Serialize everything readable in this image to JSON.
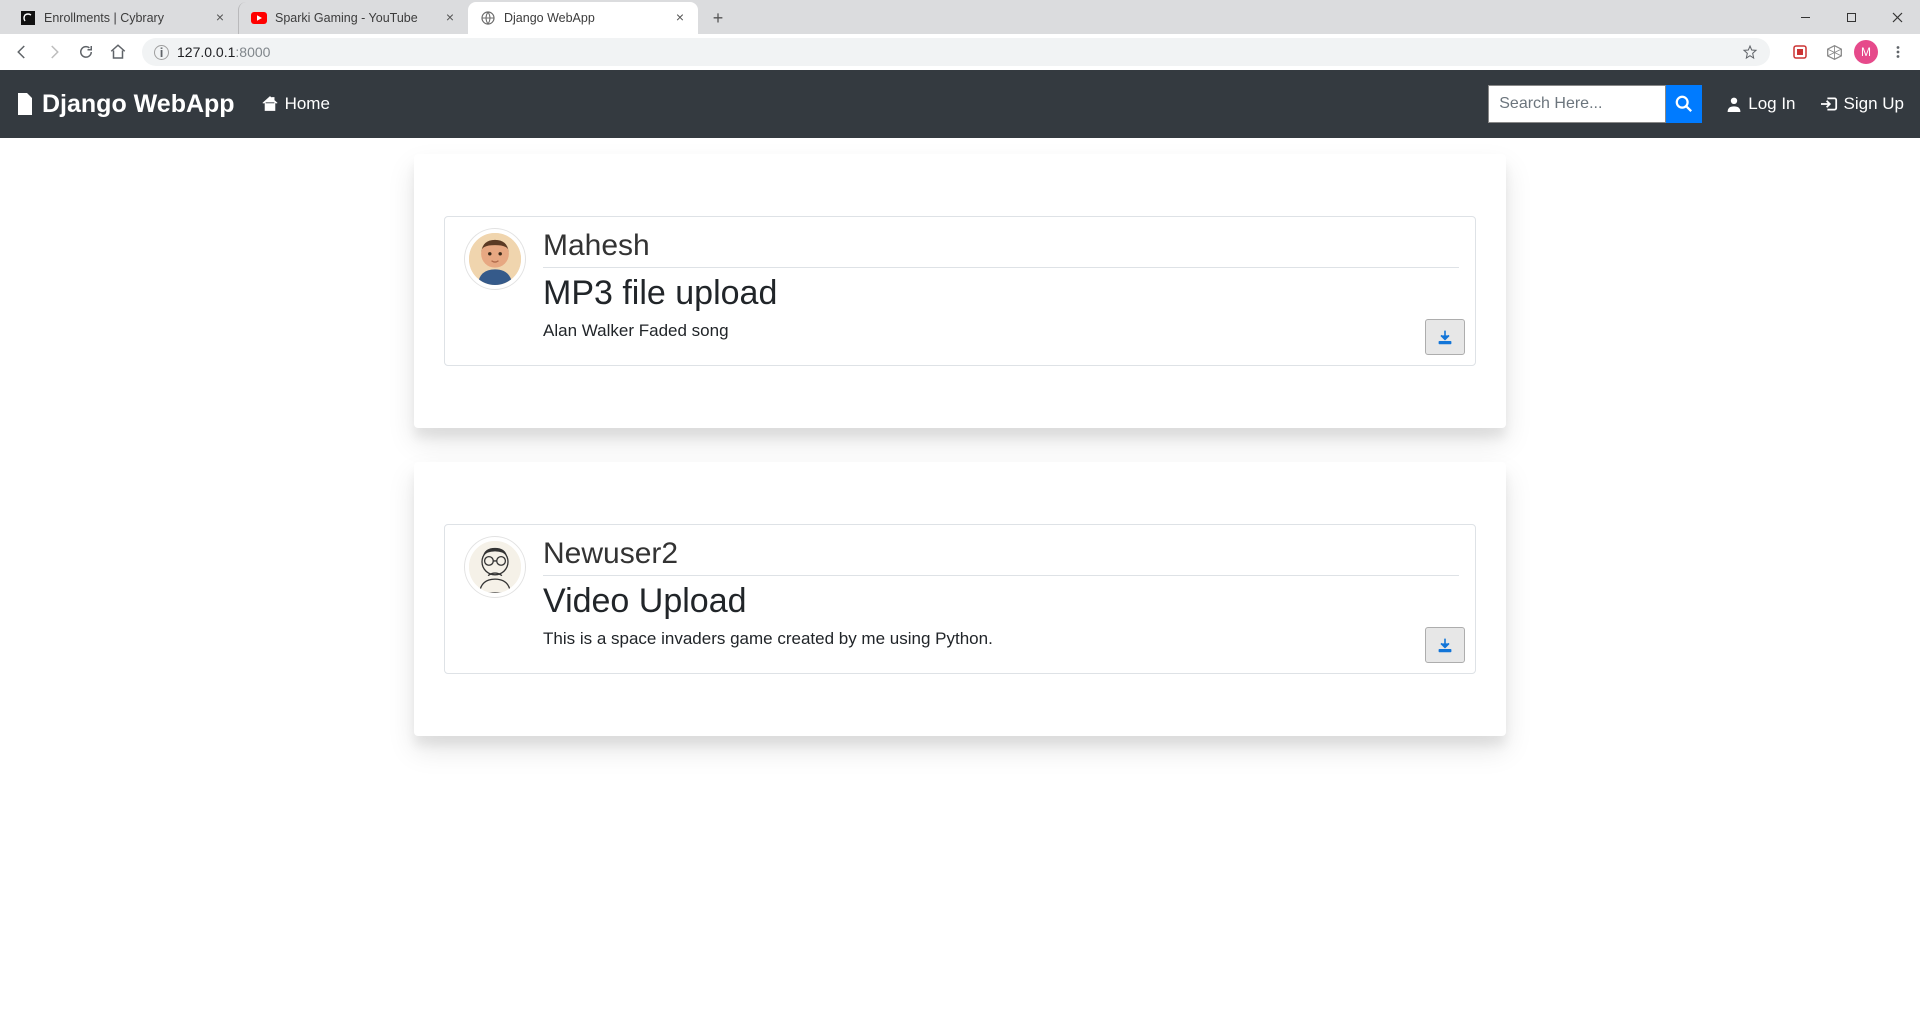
{
  "browser": {
    "tabs": [
      {
        "title": "Enrollments | Cybrary",
        "favicon": "cybrary",
        "active": false
      },
      {
        "title": "Sparki Gaming - YouTube",
        "favicon": "youtube",
        "active": false
      },
      {
        "title": "Django WebApp",
        "favicon": "globe",
        "active": true
      }
    ],
    "address": {
      "host": "127.0.0.1",
      "port": ":8000"
    },
    "profile_initial": "M"
  },
  "navbar": {
    "brand": "Django WebApp",
    "home": "Home",
    "search_placeholder": "Search Here...",
    "login": "Log In",
    "signup": "Sign Up"
  },
  "posts": [
    {
      "user": "Mahesh",
      "avatar": "face1",
      "title": "MP3 file upload",
      "description": "Alan Walker Faded song"
    },
    {
      "user": "Newuser2",
      "avatar": "face2",
      "title": "Video Upload",
      "description": "This is a space invaders game created by me using Python."
    }
  ]
}
